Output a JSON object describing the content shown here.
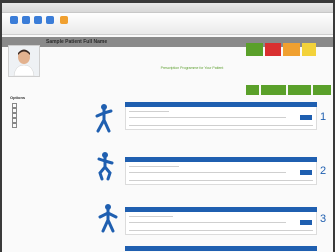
{
  "window": {
    "title": ""
  },
  "toolbar": {
    "buttons": [
      {
        "icon": "back-icon",
        "color": "#3b7dd8",
        "label": ""
      },
      {
        "icon": "forward-icon",
        "color": "#3b7dd8",
        "label": ""
      },
      {
        "icon": "print-icon",
        "color": "#3b7dd8",
        "label": ""
      },
      {
        "icon": "save-icon",
        "color": "#3b7dd8",
        "label": ""
      },
      {
        "icon": "export-icon",
        "color": "#f0a030",
        "label": ""
      }
    ]
  },
  "profile": {
    "name": "Sample Patient Full Name"
  },
  "status": {
    "colors": [
      "#5aa02a",
      "#d93030",
      "#f0a030",
      "#f3d23a"
    ]
  },
  "header": {
    "title": "Prescription Programme for Your Patient",
    "subtitle": ""
  },
  "actions": {
    "labels": [
      "",
      "",
      "",
      ""
    ],
    "color": "#5aa02a"
  },
  "sidebar": {
    "title": "Options",
    "items": [
      "",
      "",
      "",
      "",
      ""
    ]
  },
  "exercises": [
    {
      "number": "1",
      "caption": ""
    },
    {
      "number": "2",
      "caption": ""
    },
    {
      "number": "3",
      "caption": ""
    }
  ],
  "accent": "#1f5fb0"
}
